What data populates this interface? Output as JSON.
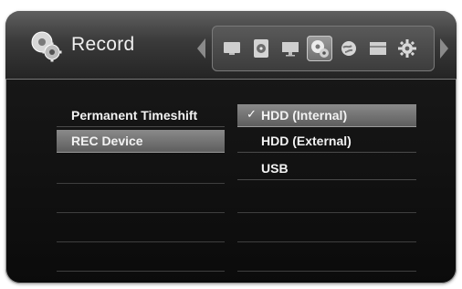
{
  "header": {
    "title": "Record",
    "icons": [
      "tv-icon",
      "disc-icon",
      "monitor-icon",
      "record-icon",
      "globe-icon",
      "film-icon",
      "settings-icon"
    ],
    "selected_icon_index": 3
  },
  "menu": {
    "items": [
      {
        "label": "Permanent Timeshift",
        "highlighted": false
      },
      {
        "label": "REC Device",
        "highlighted": true
      }
    ]
  },
  "options": {
    "items": [
      {
        "label": "HDD (Internal)",
        "checked": true,
        "highlighted": true
      },
      {
        "label": "HDD (External)",
        "checked": false,
        "highlighted": false
      },
      {
        "label": "USB",
        "checked": false,
        "highlighted": false
      }
    ],
    "check_mark": "✓"
  }
}
